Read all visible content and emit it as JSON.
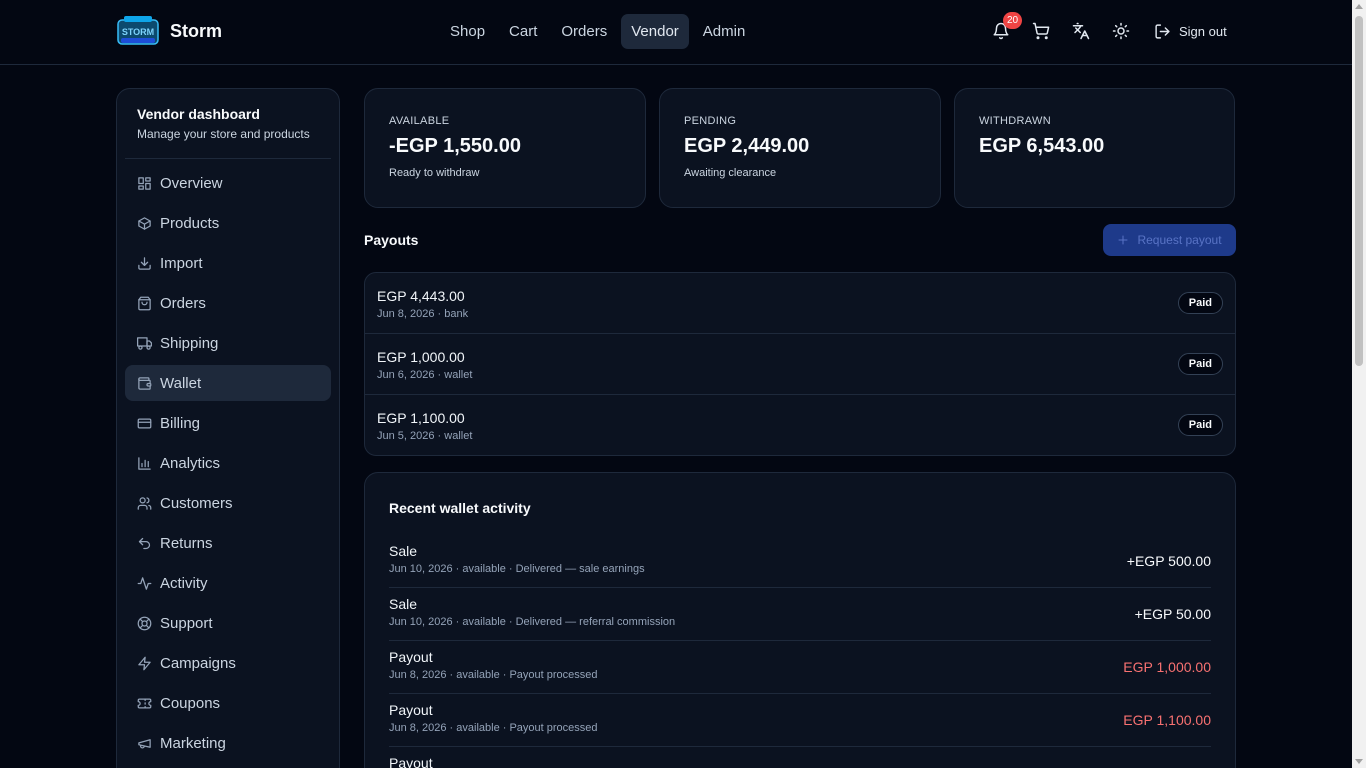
{
  "app": {
    "name": "Storm",
    "logo_text": "STORM"
  },
  "nav": [
    {
      "label": "Shop",
      "active": false
    },
    {
      "label": "Cart",
      "active": false
    },
    {
      "label": "Orders",
      "active": false
    },
    {
      "label": "Vendor",
      "active": true
    },
    {
      "label": "Admin",
      "active": false
    }
  ],
  "header": {
    "notifications_count": "20",
    "icons": [
      "bell-icon",
      "cart-icon",
      "translate-icon",
      "sun-icon",
      "sign-out-icon"
    ],
    "sign_out_label": "Sign out"
  },
  "sidebar": {
    "title": "Vendor dashboard",
    "subtitle": "Manage your store and products",
    "items": [
      {
        "label": "Overview",
        "icon": "grid-icon",
        "active": false
      },
      {
        "label": "Products",
        "icon": "box-icon",
        "active": false
      },
      {
        "label": "Import",
        "icon": "download-icon",
        "active": false
      },
      {
        "label": "Orders",
        "icon": "shopping-bag-icon",
        "active": false
      },
      {
        "label": "Shipping",
        "icon": "truck-icon",
        "active": false
      },
      {
        "label": "Wallet",
        "icon": "wallet-icon",
        "active": true
      },
      {
        "label": "Billing",
        "icon": "credit-card-icon",
        "active": false
      },
      {
        "label": "Analytics",
        "icon": "bar-chart-icon",
        "active": false
      },
      {
        "label": "Customers",
        "icon": "users-icon",
        "active": false
      },
      {
        "label": "Returns",
        "icon": "undo-icon",
        "active": false
      },
      {
        "label": "Activity",
        "icon": "pulse-icon",
        "active": false
      },
      {
        "label": "Support",
        "icon": "lifebuoy-icon",
        "active": false
      },
      {
        "label": "Campaigns",
        "icon": "zap-icon",
        "active": false
      },
      {
        "label": "Coupons",
        "icon": "ticket-icon",
        "active": false
      },
      {
        "label": "Marketing",
        "icon": "megaphone-icon",
        "active": false
      }
    ]
  },
  "stats": [
    {
      "label": "AVAILABLE",
      "value": "-EGP 1,550.00",
      "note": "Ready to withdraw"
    },
    {
      "label": "PENDING",
      "value": "EGP 2,449.00",
      "note": "Awaiting clearance"
    },
    {
      "label": "WITHDRAWN",
      "value": "EGP 6,543.00",
      "note": ""
    }
  ],
  "payouts": {
    "title": "Payouts",
    "request_label": "Request payout",
    "items": [
      {
        "amount": "EGP 4,443.00",
        "meta": "Jun 8, 2026 · bank",
        "status": "Paid"
      },
      {
        "amount": "EGP 1,000.00",
        "meta": "Jun 6, 2026 · wallet",
        "status": "Paid"
      },
      {
        "amount": "EGP 1,100.00",
        "meta": "Jun 5, 2026 · wallet",
        "status": "Paid"
      }
    ]
  },
  "activity": {
    "title": "Recent wallet activity",
    "items": [
      {
        "type": "Sale",
        "meta": "Jun 10, 2026 · available · Delivered — sale earnings",
        "amount": "+EGP 500.00",
        "negative": false
      },
      {
        "type": "Sale",
        "meta": "Jun 10, 2026 · available · Delivered — referral commission",
        "amount": "+EGP 50.00",
        "negative": false
      },
      {
        "type": "Payout",
        "meta": "Jun 8, 2026 · available · Payout processed",
        "amount": "EGP 1,000.00",
        "negative": true
      },
      {
        "type": "Payout",
        "meta": "Jun 8, 2026 · available · Payout processed",
        "amount": "EGP 1,100.00",
        "negative": true
      },
      {
        "type": "Payout",
        "meta": "",
        "amount": "",
        "negative": true
      }
    ]
  },
  "colors": {
    "background": "#030712",
    "card": "#0b1220",
    "border": "#1e293b",
    "negative": "#f87171",
    "badge": "#ef4444",
    "primary_button": "#1e3a8a"
  }
}
